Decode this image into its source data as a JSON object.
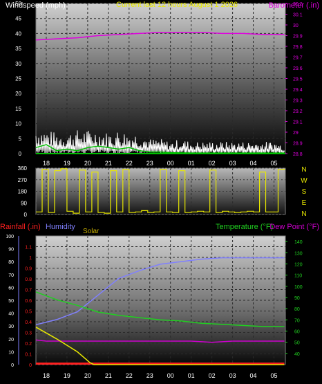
{
  "colors": {
    "wind": "#ffffff",
    "wind_avg": "#00c000",
    "barometer": "#e000e0",
    "direction": "#e8e800",
    "rain": "#ff2020",
    "humidity": "#8080ff",
    "solar": "#e8e800",
    "temperature": "#20d020",
    "dew_point": "#d000d0",
    "title": "#e8e800"
  },
  "titles": {
    "wind_label": "Windspeed (mph)",
    "main": "Current last 12 hours August 1 2026",
    "baro_label": "Barometer (.in)",
    "rain_label": "Rainfall (.in)",
    "humidity_label": "Humidity",
    "solar_label": "Solar",
    "temp_label": "Temperature (°F)",
    "dew_label": "Dew Point (°F)"
  },
  "compass": [
    "N",
    "W",
    "S",
    "E",
    "N"
  ],
  "chart_data": [
    {
      "type": "line",
      "name": "wind-barometer",
      "x_ticks": [
        "18",
        "19",
        "20",
        "21",
        "22",
        "23",
        "00",
        "01",
        "02",
        "03",
        "04",
        "05"
      ],
      "y_left": {
        "label": "Windspeed (mph)",
        "ylim": [
          0,
          50
        ],
        "ticks": [
          0,
          5,
          10,
          15,
          20,
          25,
          30,
          35,
          40,
          45,
          50
        ]
      },
      "y_right": {
        "label": "Barometer (.in)",
        "ylim": [
          28.8,
          30.2
        ],
        "ticks": [
          28.8,
          28.9,
          29,
          29.1,
          29.2,
          29.3,
          29.4,
          29.5,
          29.6,
          29.7,
          29.8,
          29.9,
          30,
          30.1,
          30.2
        ]
      },
      "series": [
        {
          "name": "Barometer",
          "axis": "right",
          "x": [
            17.5,
            18.5,
            19.5,
            20.5,
            21.5,
            22.5,
            23.5,
            24.5,
            25.5,
            26.5,
            27.5,
            28.5,
            29.5
          ],
          "values": [
            29.86,
            29.87,
            29.88,
            29.9,
            29.91,
            29.92,
            29.93,
            29.93,
            29.93,
            29.92,
            29.92,
            29.91,
            29.91
          ]
        },
        {
          "name": "Wind average",
          "axis": "left",
          "x": [
            17.5,
            18,
            18.5,
            19,
            19.5,
            20,
            20.5,
            21,
            21.5,
            22,
            22.5,
            23,
            23.5,
            24,
            25,
            26,
            27,
            28,
            29.5
          ],
          "values": [
            2,
            3,
            1,
            1.5,
            1,
            2,
            2.5,
            2,
            1.5,
            2,
            1,
            0.5,
            0.5,
            0.3,
            0.2,
            0.2,
            0.2,
            0.2,
            0.2
          ]
        }
      ],
      "wind_envelope": {
        "x": [
          17.5,
          18,
          18.5,
          19,
          19.5,
          20,
          20.5,
          21,
          21.5,
          22,
          22.5,
          23,
          23.5,
          24,
          24.5,
          25,
          25.5,
          26,
          26.5,
          27,
          27.5,
          28,
          28.5,
          29,
          29.5
        ],
        "values": [
          9,
          8,
          7,
          7,
          8,
          8,
          8,
          7,
          8,
          7,
          7,
          5,
          5,
          4,
          5,
          4,
          4,
          4,
          4,
          4,
          4,
          4,
          4,
          4,
          3
        ]
      }
    },
    {
      "type": "scatter",
      "name": "wind-direction",
      "y_ticks": [
        0,
        90,
        180,
        270,
        360
      ],
      "ylim": [
        0,
        360
      ],
      "x": [
        17.5,
        17.8,
        18.1,
        18.4,
        18.7,
        19,
        19.3,
        19.6,
        19.9,
        20.2,
        20.5,
        20.8,
        21.1,
        21.4,
        21.7,
        22,
        22.3,
        22.6,
        22.9,
        23.2,
        23.5,
        23.8,
        24.1,
        24.4,
        24.7,
        25,
        25.3,
        25.6,
        25.9,
        26.2,
        26.5,
        26.8,
        27.1,
        27.4,
        27.7,
        28,
        28.3,
        28.6,
        28.9,
        29.2,
        29.5
      ],
      "values": [
        20,
        350,
        15,
        340,
        355,
        25,
        10,
        345,
        20,
        330,
        15,
        10,
        340,
        20,
        350,
        15,
        20,
        30,
        15,
        20,
        350,
        20,
        15,
        340,
        15,
        20,
        25,
        20,
        345,
        15,
        25,
        20,
        15,
        20,
        25,
        20,
        330,
        20,
        20,
        350,
        355
      ]
    },
    {
      "type": "line",
      "name": "rain-humidity-temperature",
      "x_ticks": [
        "18",
        "19",
        "20",
        "21",
        "22",
        "23",
        "00",
        "01",
        "02",
        "03",
        "04",
        "05"
      ],
      "y_rain": {
        "label": "Rainfall (.in)",
        "ylim": [
          0,
          1.2
        ],
        "ticks": [
          0,
          0.1,
          0.2,
          0.3,
          0.4,
          0.5,
          0.6,
          0.7,
          0.8,
          0.9,
          1,
          1.1
        ]
      },
      "y_humidity": {
        "label": "Humidity",
        "ylim": [
          0,
          100
        ],
        "ticks": [
          0,
          10,
          20,
          30,
          40,
          50,
          60,
          70,
          80,
          90,
          100
        ]
      },
      "y_temp": {
        "label": "Temperature (°F)",
        "ylim": [
          30,
          145
        ],
        "ticks": [
          40,
          50,
          60,
          70,
          80,
          90,
          100,
          110,
          120,
          130,
          140
        ]
      },
      "series": [
        {
          "name": "Humidity",
          "axis": "humidity",
          "x": [
            17.5,
            18.5,
            19.5,
            20.5,
            21.5,
            22.5,
            23.5,
            24.5,
            25.5,
            26.5,
            27.5,
            28.5,
            29.5
          ],
          "values": [
            31,
            35,
            41,
            54,
            67,
            73,
            78,
            80,
            82,
            83,
            83,
            83,
            83
          ]
        },
        {
          "name": "Temperature",
          "axis": "temp",
          "x": [
            17.5,
            18.5,
            19.5,
            20.5,
            21.5,
            22.5,
            23.5,
            24.5,
            25.5,
            26.5,
            27.5,
            28.5,
            29.5
          ],
          "values": [
            95,
            88,
            83,
            77,
            74,
            72,
            70,
            69,
            67,
            66,
            65,
            64,
            64
          ]
        },
        {
          "name": "Dew Point",
          "axis": "temp",
          "x": [
            17.5,
            18,
            18.5,
            19,
            20,
            21,
            22,
            23,
            24,
            25,
            26,
            27,
            28,
            29,
            29.5
          ],
          "values": [
            52,
            51,
            51,
            51,
            51,
            51,
            51,
            51,
            51,
            51,
            50,
            51,
            51,
            51,
            51
          ]
        },
        {
          "name": "Rainfall",
          "axis": "rain",
          "x": [
            17.5,
            29.5
          ],
          "values": [
            0.01,
            0.01
          ]
        },
        {
          "name": "Solar",
          "axis": "rain",
          "x": [
            17.5,
            18.5,
            19.5,
            20.1,
            20.3,
            29.5
          ],
          "values": [
            0.35,
            0.24,
            0.12,
            0.02,
            0,
            0
          ]
        }
      ]
    }
  ]
}
